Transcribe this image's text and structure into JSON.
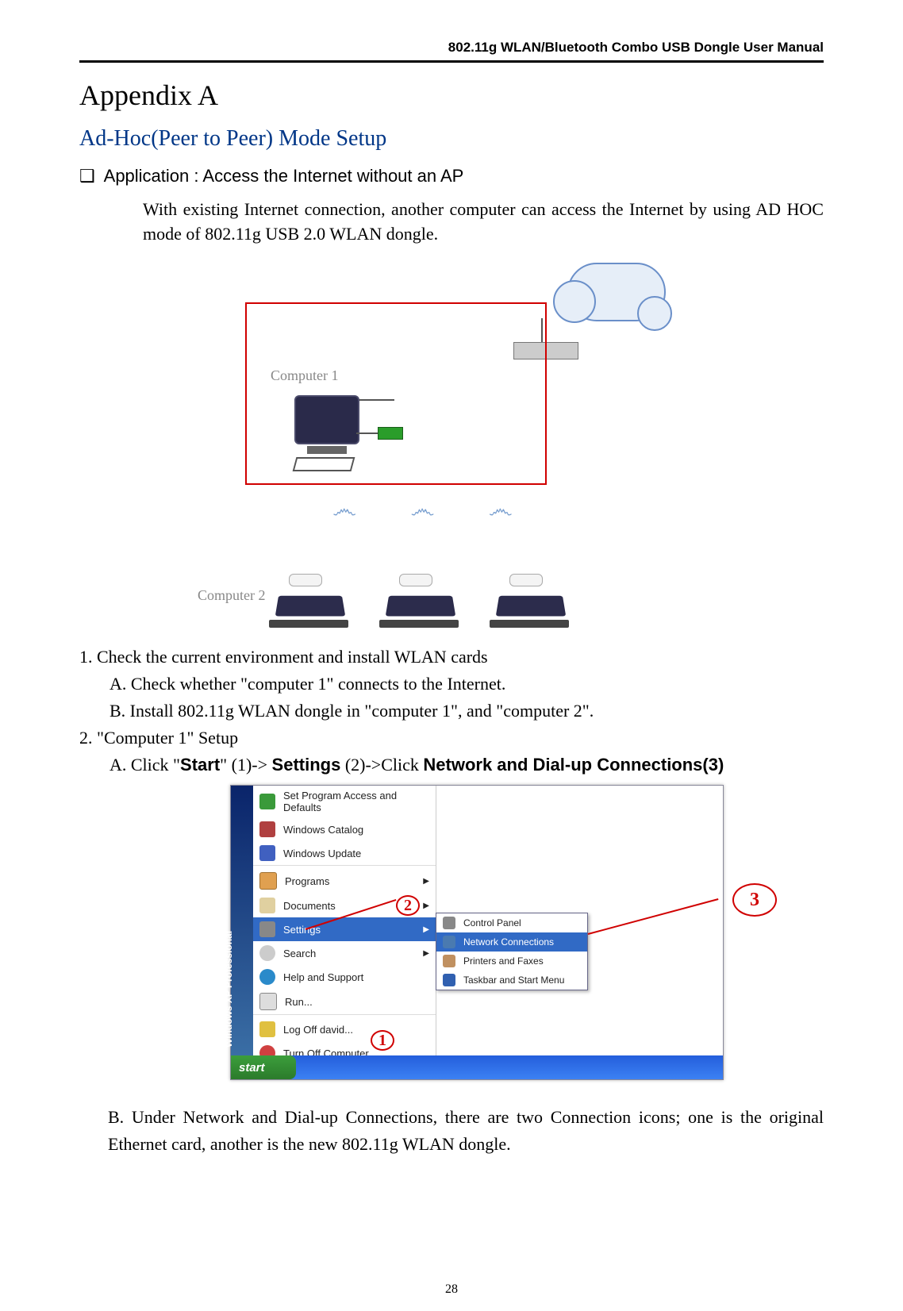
{
  "header": "802.11g WLAN/Bluetooth Combo USB Dongle User Manual",
  "title": "Appendix  A",
  "subtitle": "Ad-Hoc(Peer to Peer) Mode Setup",
  "bullet_prefix": "❑",
  "bullet_text": "Application : Access the Internet without an AP",
  "intro": "With existing Internet connection, another computer can access the Internet by using AD HOC mode of 802.11g USB 2.0 WLAN dongle.",
  "diagram": {
    "comp1": "Computer 1",
    "comp2": "Computer 2"
  },
  "list": {
    "item1": "1. Check the current environment and install WLAN cards",
    "item1a": "A.   Check whether \"computer 1\" connects to the Internet.",
    "item1b": "B.   Install 802.11g WLAN dongle in \"computer 1\", and \"computer 2\".",
    "item2": "2. \"Computer 1\" Setup",
    "item2a_pre": "A. Click \"",
    "start": "Start",
    "mid1": "\" (1)-> ",
    "settings": "Settings",
    "mid2": " (2)->Click ",
    "ndc": "Network and Dial-up Connections(3)",
    "item2b": "B. Under Network and Dial-up Connections, there are two Connection icons; one is the original Ethernet card, another is the new 802.11g WLAN dongle."
  },
  "startmenu": {
    "strip": "Windows XP Professional",
    "items": [
      "Set Program Access and Defaults",
      "Windows Catalog",
      "Windows Update",
      "Programs",
      "Documents",
      "Settings",
      "Search",
      "Help and Support",
      "Run...",
      "Log Off david...",
      "Turn Off Computer..."
    ],
    "sub": [
      "Control Panel",
      "Network Connections",
      "Printers and Faxes",
      "Taskbar and Start Menu"
    ],
    "start_btn": "start"
  },
  "callouts": {
    "c1": "1",
    "c2": "2",
    "c3": "3"
  },
  "page_num": "28"
}
